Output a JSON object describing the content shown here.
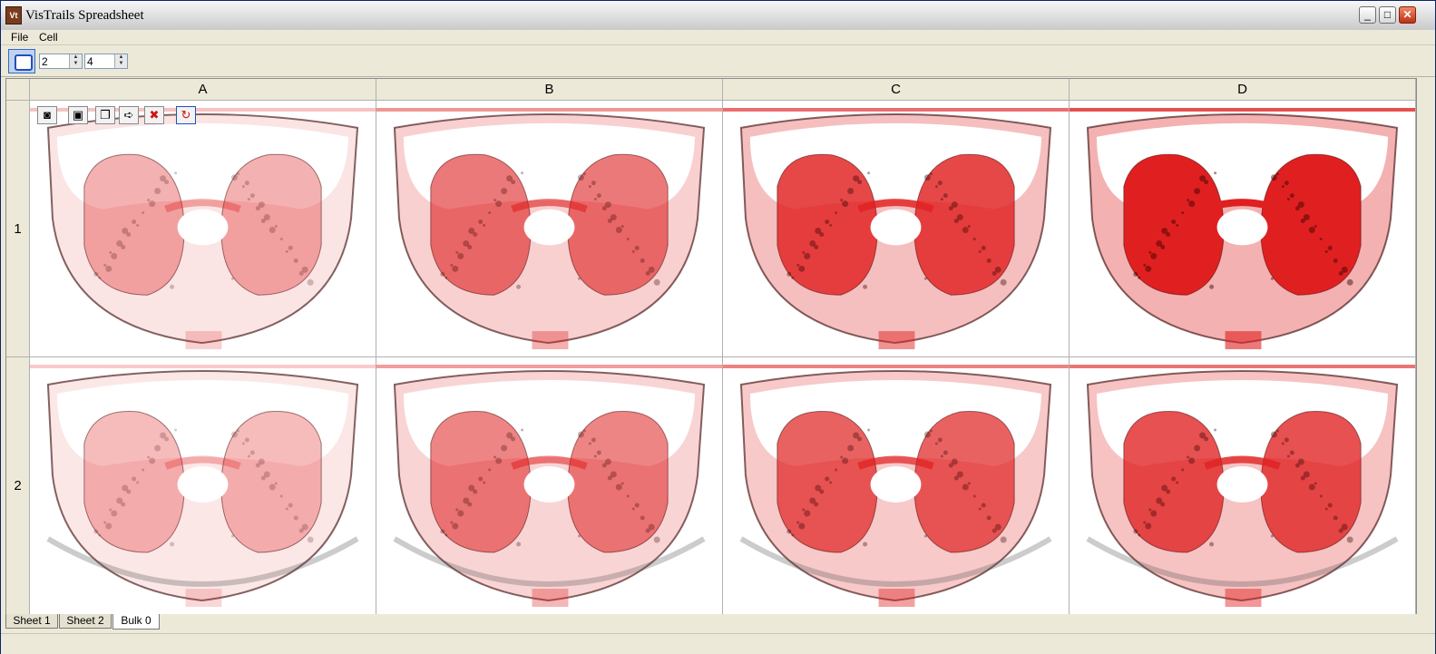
{
  "window": {
    "title": "VisTrails Spreadsheet",
    "app_icon_text": "Vt",
    "minimize_glyph": "_",
    "maximize_glyph": "□",
    "close_glyph": "✕"
  },
  "menu": {
    "file": "File",
    "cell": "Cell"
  },
  "toolbar": {
    "rows_value": "2",
    "cols_value": "4"
  },
  "grid": {
    "columns": [
      "A",
      "B",
      "C",
      "D"
    ],
    "rows": [
      "1",
      "2"
    ],
    "cell_toolbar_icons": [
      "camera-icon",
      "save-image-icon",
      "copy-icon",
      "export-icon",
      "delete-icon",
      "refresh-icon"
    ],
    "render_color": "#e02020"
  },
  "tabs": [
    "Sheet 1",
    "Sheet 2",
    "Bulk 0"
  ]
}
